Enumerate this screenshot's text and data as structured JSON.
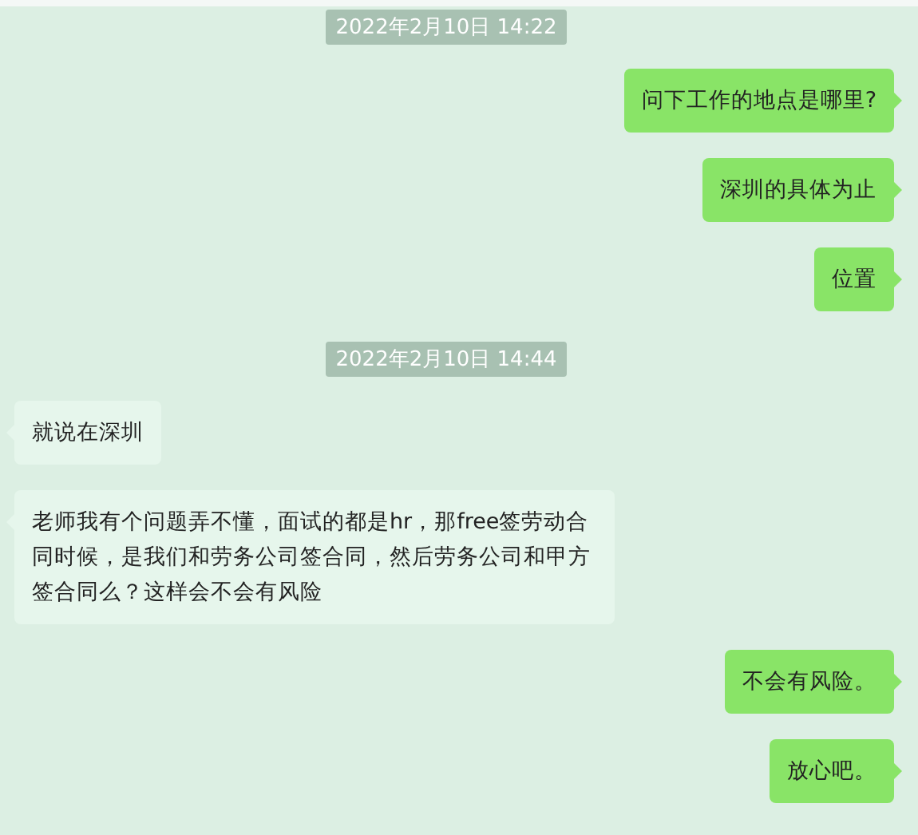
{
  "messages": [
    {
      "kind": "timestamp",
      "text": "2022年2月10日 14:22"
    },
    {
      "kind": "message",
      "outgoing": true,
      "text": "问下工作的地点是哪里?"
    },
    {
      "kind": "message",
      "outgoing": true,
      "text": "深圳的具体为止"
    },
    {
      "kind": "message",
      "outgoing": true,
      "text": "位置"
    },
    {
      "kind": "timestamp",
      "text": "2022年2月10日 14:44"
    },
    {
      "kind": "message",
      "outgoing": false,
      "text": "就说在深圳"
    },
    {
      "kind": "message",
      "outgoing": false,
      "text": "老师我有个问题弄不懂，面试的都是hr，那free签劳动合同时候，是我们和劳务公司签合同，然后劳务公司和甲方签合同么？这样会不会有风险"
    },
    {
      "kind": "message",
      "outgoing": true,
      "text": "不会有风险。"
    },
    {
      "kind": "message",
      "outgoing": true,
      "text": "放心吧。"
    }
  ]
}
